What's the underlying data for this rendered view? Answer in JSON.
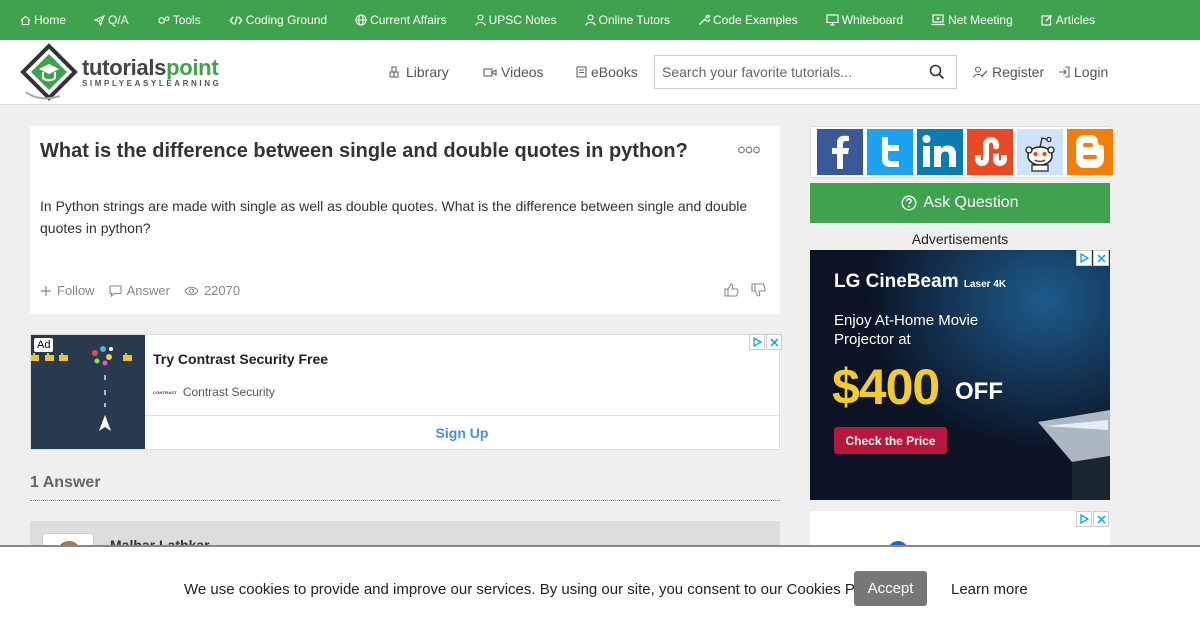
{
  "topnav": [
    {
      "label": "Home",
      "icon": "home-icon"
    },
    {
      "label": "Q/A",
      "icon": "paper-plane-icon"
    },
    {
      "label": "Tools",
      "icon": "cogs-icon"
    },
    {
      "label": "Coding Ground",
      "icon": "code-icon"
    },
    {
      "label": "Current Affairs",
      "icon": "globe-icon"
    },
    {
      "label": "UPSC Notes",
      "icon": "user-icon"
    },
    {
      "label": "Online Tutors",
      "icon": "user-icon"
    },
    {
      "label": "Code Examples",
      "icon": "wrench-icon"
    },
    {
      "label": "Whiteboard",
      "icon": "monitor-icon"
    },
    {
      "label": "Net Meeting",
      "icon": "meeting-icon"
    },
    {
      "label": "Articles",
      "icon": "edit-icon"
    }
  ],
  "header": {
    "logo_main_a": "tutorials",
    "logo_main_b": "point",
    "logo_sub": "SIMPLYEASYLEARNING",
    "library": "Library",
    "videos": "Videos",
    "ebooks": "eBooks",
    "search_placeholder": "Search your favorite tutorials...",
    "register": "Register",
    "login": "Login"
  },
  "question": {
    "title": "What is the difference between single and double quotes in python?",
    "body": "In Python strings are made with single as well as double quotes. What is the difference between single and double quotes in python?",
    "follow": "Follow",
    "answer": "Answer",
    "views": "22070"
  },
  "ad1": {
    "badge": "Ad",
    "title": "Try Contrast Security Free",
    "brand_logo": "CONTRAST",
    "brand": "Contrast Security",
    "cta": "Sign Up"
  },
  "answers": {
    "heading": "1 Answer",
    "first_author": "Malhar Lathkar"
  },
  "sidebar": {
    "social": [
      {
        "name": "facebook-icon",
        "glyph": "f",
        "color": "#3b5998"
      },
      {
        "name": "twitter-icon",
        "glyph": "t",
        "color": "#1da1f2"
      },
      {
        "name": "linkedin-icon",
        "glyph": "in",
        "color": "#0a7bb5"
      },
      {
        "name": "stumbleupon-icon",
        "glyph": "SU",
        "color": "#eb4924"
      },
      {
        "name": "reddit-icon",
        "glyph": "R",
        "color": "#cee3f8"
      },
      {
        "name": "blogger-icon",
        "glyph": "B",
        "color": "#f57d00"
      }
    ],
    "ask_label": "Ask Question",
    "ads_label": "Advertisements"
  },
  "lgad": {
    "brand": "LG CineBeam",
    "brand_suffix": "Laser 4K",
    "copy": "Enjoy At-Home Movie Projector at",
    "price": "$400",
    "off": "OFF",
    "cta": "Check the Price"
  },
  "cookie": {
    "text": "We use cookies to provide and improve our services. By using our site, you consent to our Cookies Policy.",
    "accept": "Accept",
    "learn_more": "Learn more"
  },
  "colors": {
    "brand_green": "#3fa34d",
    "ad_link_blue": "#4a90d9",
    "lg_yellow": "#f2cc2e",
    "lg_red": "#b8163b",
    "accept_gray": "#777777"
  }
}
